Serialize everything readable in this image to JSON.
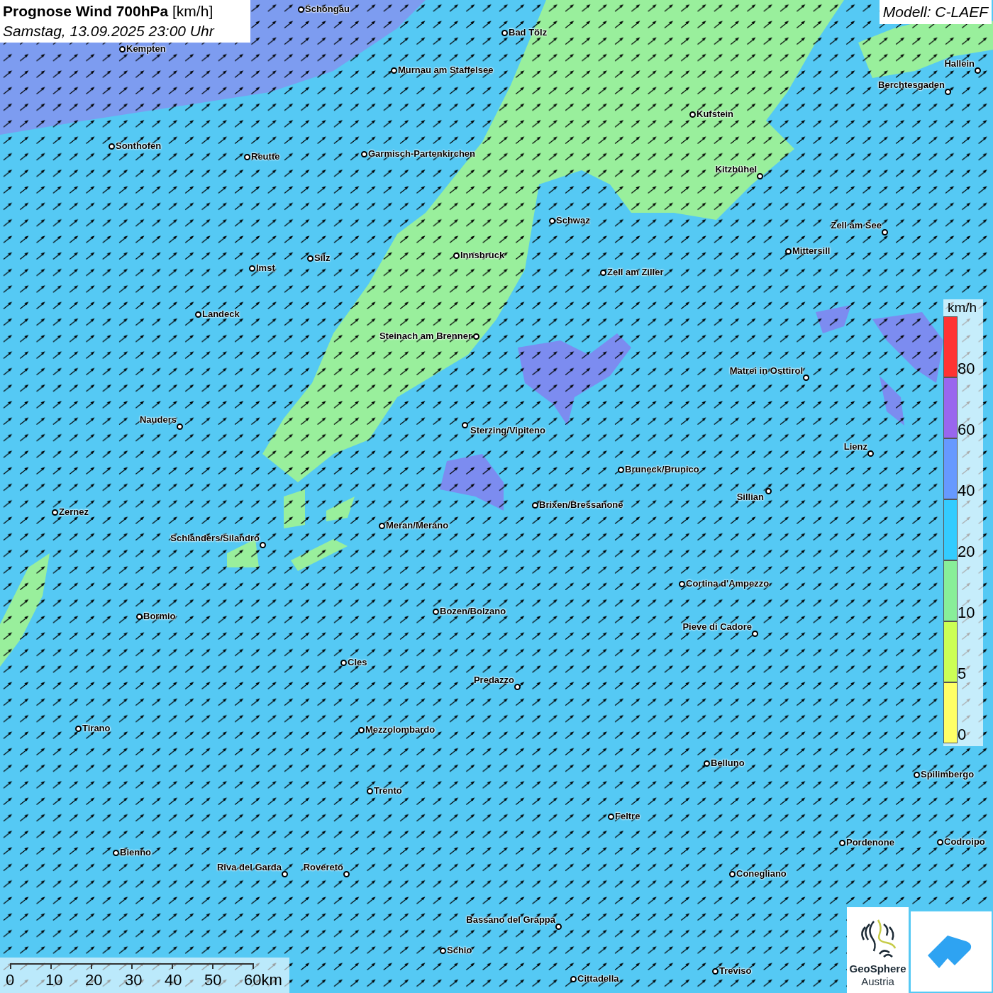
{
  "title": "**Prognose Wind 700hPa** [km/h]",
  "subtitle": "Samstag, 13.09.2025 23:00 Uhr",
  "model": "Modell: C-LAEF",
  "cities": [
    {
      "name": "Schongau"
    },
    {
      "name": "Kempten"
    },
    {
      "name": "Bad Tölz"
    },
    {
      "name": "Murnau am Staffelsee"
    },
    {
      "name": "Hallein"
    },
    {
      "name": "Berchtesgaden"
    },
    {
      "name": "Kufstein"
    },
    {
      "name": "Sonthofen"
    },
    {
      "name": "Reutte"
    },
    {
      "name": "Garmisch-Partenkirchen"
    },
    {
      "name": "Kitzbühel"
    },
    {
      "name": "Schwaz"
    },
    {
      "name": "Zell am See"
    },
    {
      "name": "Mittersill"
    },
    {
      "name": "Innsbruck"
    },
    {
      "name": "Silz"
    },
    {
      "name": "Imst"
    },
    {
      "name": "Zell am Ziller"
    },
    {
      "name": "Landeck"
    },
    {
      "name": "Steinach am Brenner"
    },
    {
      "name": "Matrei in Osttirol"
    },
    {
      "name": "Nauders"
    },
    {
      "name": "Sterzing/Vipiteno"
    },
    {
      "name": "Lienz"
    },
    {
      "name": "Bruneck/Brunico"
    },
    {
      "name": "Sillian"
    },
    {
      "name": "Brixen/Bressanone"
    },
    {
      "name": "Zernez"
    },
    {
      "name": "Meran/Merano"
    },
    {
      "name": "Schlanders/Silandro"
    },
    {
      "name": "Cortina d'Ampezzo"
    },
    {
      "name": "Bozen/Bolzano"
    },
    {
      "name": "Bormio"
    },
    {
      "name": "Pieve di Cadore"
    },
    {
      "name": "Cles"
    },
    {
      "name": "Predazzo"
    },
    {
      "name": "Tirano"
    },
    {
      "name": "Mezzolombardo"
    },
    {
      "name": "Belluno"
    },
    {
      "name": "Spilimbergo"
    },
    {
      "name": "Trento"
    },
    {
      "name": "Feltre"
    },
    {
      "name": "Pordenone"
    },
    {
      "name": "Codroipo"
    },
    {
      "name": "Bienno"
    },
    {
      "name": "Riva del Garda"
    },
    {
      "name": "Rovereto"
    },
    {
      "name": "Conegliano"
    },
    {
      "name": "Bassano del Grappa"
    },
    {
      "name": "Schio"
    },
    {
      "name": "Treviso"
    },
    {
      "name": "Cittadella"
    }
  ],
  "legend": {
    "unit": "km/h",
    "bands": [
      {
        "color": "#ff3333",
        "label": "80"
      },
      {
        "color": "#9966ee",
        "label": "60"
      },
      {
        "color": "#6699ff",
        "label": "40"
      },
      {
        "color": "#33ccff",
        "label": "20"
      },
      {
        "color": "#88ee99",
        "label": "10"
      },
      {
        "color": "#ccff55",
        "label": "5"
      },
      {
        "color": "#ffff66",
        "label": "0"
      }
    ]
  },
  "scale_bar": {
    "ticks": [
      "0",
      "10",
      "20",
      "30",
      "40",
      "50",
      "60km"
    ]
  },
  "logo": {
    "name": "GeoSphere",
    "subtitle": "Austria"
  }
}
